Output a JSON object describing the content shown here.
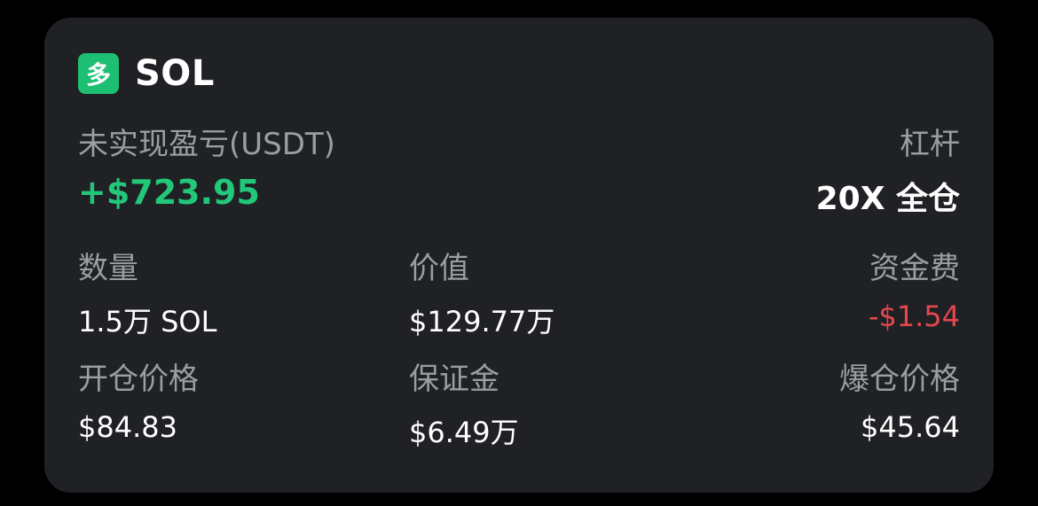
{
  "position": {
    "side_badge": "多",
    "symbol": "SOL",
    "unrealized_pnl_label": "未实现盈亏(USDT)",
    "unrealized_pnl_value": "+$723.95",
    "leverage_label": "杠杆",
    "leverage_value": "20X 全仓",
    "quantity_label": "数量",
    "quantity_value": "1.5万 SOL",
    "value_label": "价值",
    "value_value": "$129.77万",
    "funding_fee_label": "资金费",
    "funding_fee_value": "-$1.54",
    "entry_price_label": "开仓价格",
    "entry_price_value": "$84.83",
    "margin_label": "保证金",
    "margin_value": "$6.49万",
    "liquidation_price_label": "爆仓价格",
    "liquidation_price_value": "$45.64"
  },
  "colors": {
    "background": "#000000",
    "card": "#1f2124",
    "positive": "#22c77a",
    "negative": "#e5484d",
    "badge": "#1dbf73",
    "label": "#9a9da2",
    "text": "#ffffff"
  }
}
